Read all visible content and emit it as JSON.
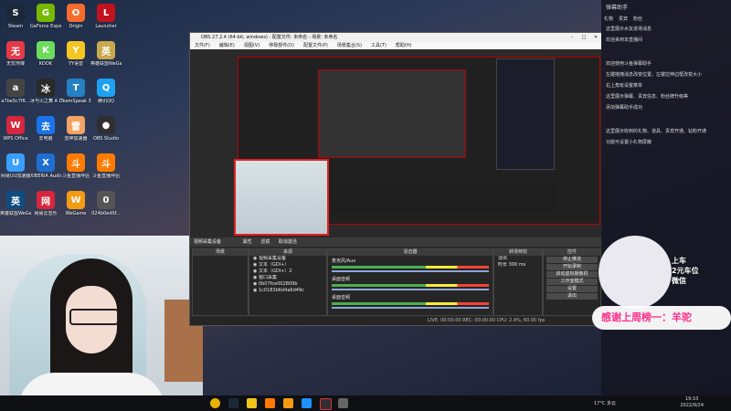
{
  "desktop": {
    "icons": [
      {
        "label": "Steam",
        "color": "#1b2838",
        "glyph": "S"
      },
      {
        "label": "GeForce Experience",
        "color": "#76b900",
        "glyph": "G"
      },
      {
        "label": "Origin",
        "color": "#f56c2d",
        "glyph": "O"
      },
      {
        "label": "Launcher",
        "color": "#c1121f",
        "glyph": "L"
      },
      {
        "label": "无忧传媒",
        "color": "#e63946",
        "glyph": "无"
      },
      {
        "label": "KOOK",
        "color": "#6bdc5c",
        "glyph": "K"
      },
      {
        "label": "YY语音",
        "color": "#f3c623",
        "glyph": "Y"
      },
      {
        "label": "英雄联盟WeGame版",
        "color": "#c8a84b",
        "glyph": "英"
      },
      {
        "label": "a7be5c7f6...",
        "color": "#444",
        "glyph": "a"
      },
      {
        "label": "冰与火之舞 A Dance of F...",
        "color": "#2a2a2a",
        "glyph": "冰"
      },
      {
        "label": "TeamSpeak 3",
        "color": "#2580c3",
        "glyph": "T"
      },
      {
        "label": "腾讯QQ",
        "color": "#1ea1f3",
        "glyph": "Q"
      },
      {
        "label": "WPS Office",
        "color": "#d7263d",
        "glyph": "W"
      },
      {
        "label": "去电脑",
        "color": "#1a73e8",
        "glyph": "去"
      },
      {
        "label": "雷神加速器",
        "color": "#f4a261",
        "glyph": "雷"
      },
      {
        "label": "OBS Studio",
        "color": "#302e31",
        "glyph": "●"
      },
      {
        "label": "网易UU加速器",
        "color": "#3aa0ff",
        "glyph": "U"
      },
      {
        "label": "XIBERIA Audio C...",
        "color": "#1f6fd1",
        "glyph": "X"
      },
      {
        "label": "斗鱼直播伴侣",
        "color": "#ff7b00",
        "glyph": "斗"
      },
      {
        "label": "斗鱼直播伴侣",
        "color": "#ff7b00",
        "glyph": "斗"
      },
      {
        "label": "英雄联盟WeGame版",
        "color": "#0f4c81",
        "glyph": "英"
      },
      {
        "label": "网易云音乐",
        "color": "#d7263d",
        "glyph": "网"
      },
      {
        "label": "WeGame",
        "color": "#f39c12",
        "glyph": "W"
      },
      {
        "label": "024b0ed0f...",
        "color": "#555",
        "glyph": "0"
      }
    ]
  },
  "obs": {
    "title": "OBS 27.2.4 (64-bit, windows) - 配置文件: 未命名 - 场景: 未命名",
    "menu": [
      "文件(F)",
      "编辑(E)",
      "视图(V)",
      "停靠部件(D)",
      "配置文件(P)",
      "场景集合(S)",
      "工具(T)",
      "帮助(H)"
    ],
    "scene_bar": {
      "source_label": "视频采集设备",
      "props_label": "属性",
      "filters_label": "滤镜",
      "device_label": "取消激活"
    },
    "docks": {
      "scenes": "场景",
      "sources": "来源",
      "mixer": "混音器",
      "transitions": "转场特效",
      "controls": "控件"
    },
    "sources": [
      "视频采集设备",
      "文本（GDI+）",
      "文本（GDI+）2",
      "窗口采集",
      "0b07fce002809b",
      "1c0183b6d4a6d49c"
    ],
    "mixer": [
      {
        "name": "麦克风/Aux",
        "level": "0.0 dB"
      },
      {
        "name": "桌面音频",
        "level": "0.0 dB"
      },
      {
        "name": "桌面音频",
        "level": "0.0 dB"
      }
    ],
    "transition": {
      "type": "淡出",
      "duration_label": "时长",
      "duration": "300 ms"
    },
    "controls": [
      "停止推流",
      "开始录制",
      "启动虚拟摄像机",
      "工作室模式",
      "设置",
      "退出"
    ],
    "status": "LIVE: 00:00:00   REC: 00:00:00   CPU: 2.4%, 60.00 fps"
  },
  "chat": {
    "header": "弹幕助手",
    "tabs": [
      "礼物",
      "贵宾",
      "粉丝"
    ],
    "messages": [
      "这里展示水友进场消息",
      "欢迎来到本直播间",
      "欢迎使用斗鱼弹幕助手",
      "左键拖拽消息改变位置，左键拉伸边框改变大小",
      "右上角有设置菜单",
      "这里展示弹幕、贵宾信息、粉丝牌升级等",
      "添加弹幕助手成功",
      "这里展示收到的礼物、道具、贵宾开通、钻粉开通",
      "功能可设置小礼物屏蔽"
    ]
  },
  "overlay": {
    "banner": "感谢上周榜一：羊驼",
    "notice_lines": [
      "上车",
      "2元车位",
      "微信"
    ]
  },
  "taskbar": {
    "weather": "17°C 多云",
    "time": "19:10",
    "date": "2022/9/24"
  }
}
